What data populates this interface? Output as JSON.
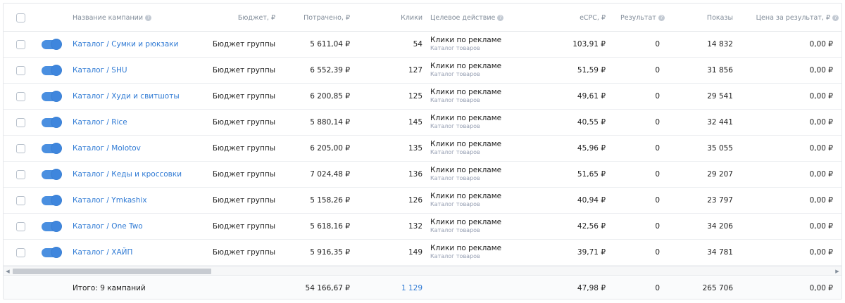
{
  "header": {
    "name": "Название кампании",
    "budget": "Бюджет, ₽",
    "spent": "Потрачено, ₽",
    "clicks": "Клики",
    "goal": "Целевое действие",
    "cpc": "eCPC, ₽",
    "result": "Результат",
    "shows": "Показы",
    "price_per_result": "Цена за результат, ₽"
  },
  "rows": [
    {
      "name": "Каталог / Сумки и рюкзаки",
      "budget": "Бюджет группы",
      "spent": "5 611,04 ₽",
      "clicks": "54",
      "goal": "Клики по рекламе",
      "goal_sub": "Каталог товаров",
      "cpc": "103,91 ₽",
      "result": "0",
      "shows": "14 832",
      "price": "0,00 ₽"
    },
    {
      "name": "Каталог / SHU",
      "budget": "Бюджет группы",
      "spent": "6 552,39 ₽",
      "clicks": "127",
      "goal": "Клики по рекламе",
      "goal_sub": "Каталог товаров",
      "cpc": "51,59 ₽",
      "result": "0",
      "shows": "31 856",
      "price": "0,00 ₽"
    },
    {
      "name": "Каталог / Худи и свитшоты",
      "budget": "Бюджет группы",
      "spent": "6 200,85 ₽",
      "clicks": "125",
      "goal": "Клики по рекламе",
      "goal_sub": "Каталог товаров",
      "cpc": "49,61 ₽",
      "result": "0",
      "shows": "29 541",
      "price": "0,00 ₽"
    },
    {
      "name": "Каталог / Rice",
      "budget": "Бюджет группы",
      "spent": "5 880,14 ₽",
      "clicks": "145",
      "goal": "Клики по рекламе",
      "goal_sub": "Каталог товаров",
      "cpc": "40,55 ₽",
      "result": "0",
      "shows": "32 441",
      "price": "0,00 ₽"
    },
    {
      "name": "Каталог / Molotov",
      "budget": "Бюджет группы",
      "spent": "6 205,00 ₽",
      "clicks": "135",
      "goal": "Клики по рекламе",
      "goal_sub": "Каталог товаров",
      "cpc": "45,96 ₽",
      "result": "0",
      "shows": "35 055",
      "price": "0,00 ₽"
    },
    {
      "name": "Каталог / Кеды и кроссовки",
      "budget": "Бюджет группы",
      "spent": "7 024,48 ₽",
      "clicks": "136",
      "goal": "Клики по рекламе",
      "goal_sub": "Каталог товаров",
      "cpc": "51,65 ₽",
      "result": "0",
      "shows": "29 207",
      "price": "0,00 ₽"
    },
    {
      "name": "Каталог / Ymkashix",
      "budget": "Бюджет группы",
      "spent": "5 158,26 ₽",
      "clicks": "126",
      "goal": "Клики по рекламе",
      "goal_sub": "Каталог товаров",
      "cpc": "40,94 ₽",
      "result": "0",
      "shows": "23 797",
      "price": "0,00 ₽"
    },
    {
      "name": "Каталог / One Two",
      "budget": "Бюджет группы",
      "spent": "5 618,16 ₽",
      "clicks": "132",
      "goal": "Клики по рекламе",
      "goal_sub": "Каталог товаров",
      "cpc": "42,56 ₽",
      "result": "0",
      "shows": "34 206",
      "price": "0,00 ₽"
    },
    {
      "name": "Каталог / ХАЙП",
      "budget": "Бюджет группы",
      "spent": "5 916,35 ₽",
      "clicks": "149",
      "goal": "Клики по рекламе",
      "goal_sub": "Каталог товаров",
      "cpc": "39,71 ₽",
      "result": "0",
      "shows": "34 781",
      "price": "0,00 ₽"
    }
  ],
  "footer": {
    "label": "Итого: 9 кампаний",
    "spent": "54 166,67 ₽",
    "clicks": "1 129",
    "cpc": "47,98 ₽",
    "result": "0",
    "shows": "265 706",
    "price": "0,00 ₽"
  },
  "colors": {
    "accent": "#2f7ad4",
    "toggle": "#4a8fe0",
    "border": "#e4e6ea"
  },
  "icons": {
    "help": "question-circle-icon",
    "scroll_left": "chevron-left-icon",
    "scroll_right": "chevron-right-icon"
  }
}
